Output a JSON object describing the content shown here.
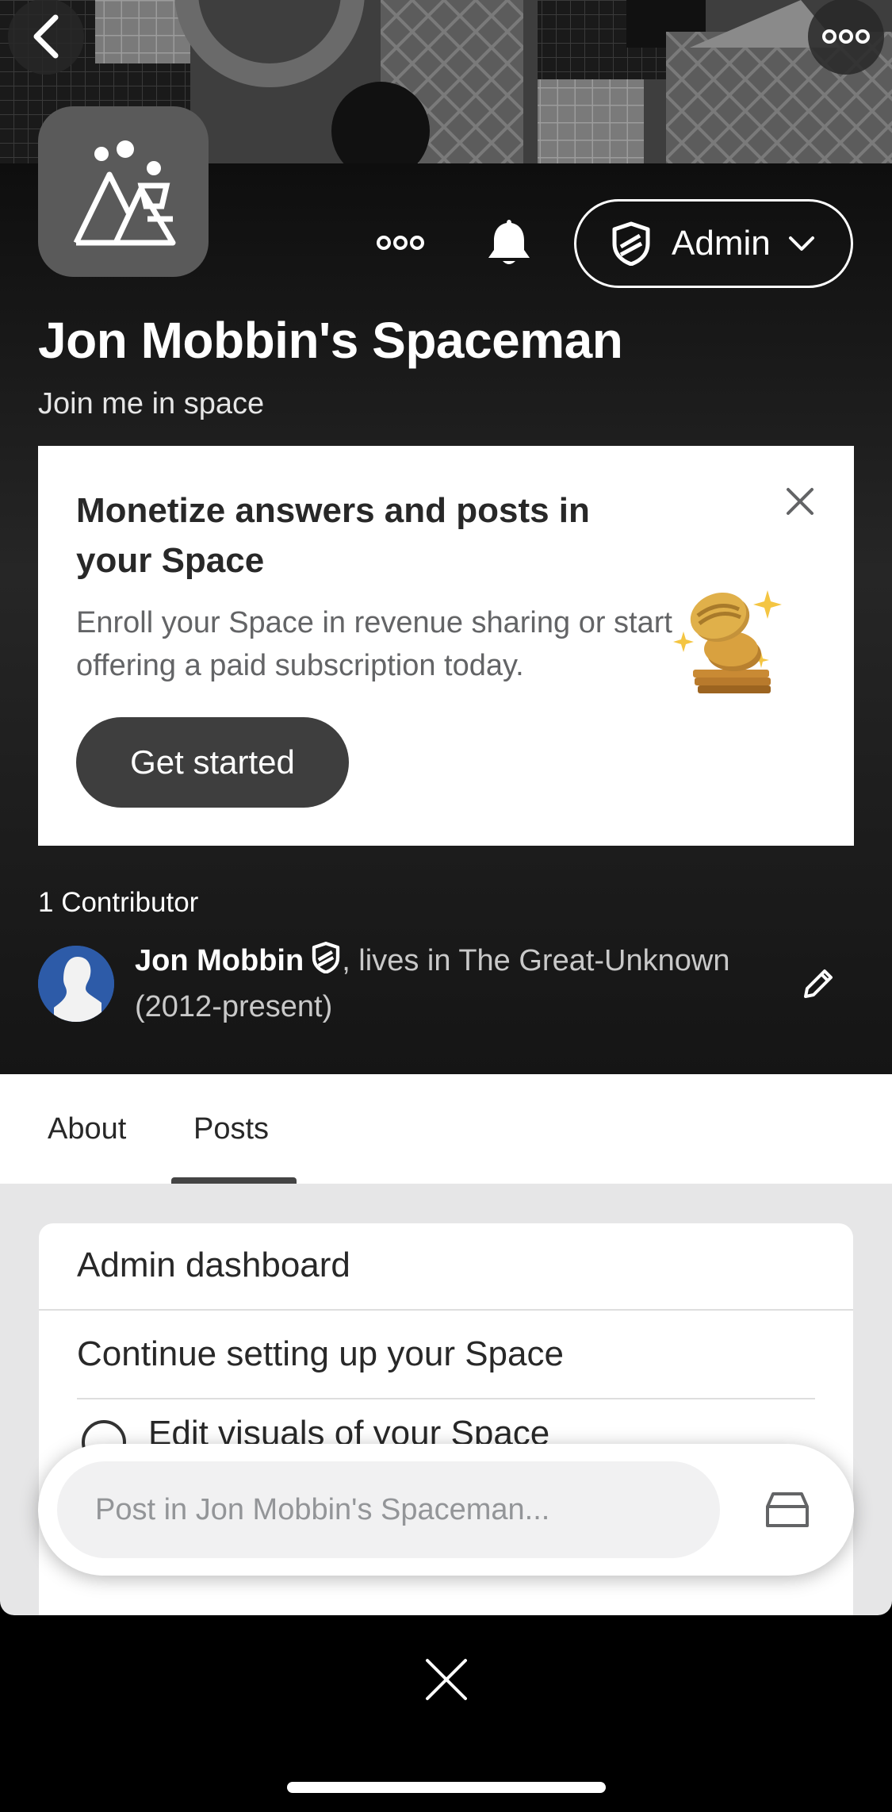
{
  "header": {
    "title": "Jon Mobbin's Spaceman",
    "tagline": "Join me in space",
    "admin_label": "Admin"
  },
  "promo": {
    "title": "Monetize answers and posts in your Space",
    "body": "Enroll your Space in revenue sharing or start offering a paid subscription today.",
    "cta": "Get started"
  },
  "contributors": {
    "count_label": "1 Contributor",
    "name": "Jon Mobbin",
    "credential": ", lives in The Great-Unknown (2012-present)"
  },
  "tabs": [
    {
      "label": "About",
      "active": false
    },
    {
      "label": "Posts",
      "active": true
    }
  ],
  "dashboard": {
    "title": "Admin dashboard",
    "subtitle": "Continue setting up your Space",
    "first_item": "Edit visuals of your Space"
  },
  "composer": {
    "placeholder": "Post in Jon Mobbin's Spaceman..."
  },
  "icons": {
    "back": "chevron-left-icon",
    "more": "more-horizontal-icon",
    "bell": "bell-icon",
    "shield": "shield-icon",
    "close": "close-icon",
    "edit": "pencil-icon",
    "drafts": "drafts-box-icon"
  },
  "colors": {
    "header_bg": "#1c1c1c",
    "button_dark": "#3e3e3e",
    "content_bg": "#e6e6e7"
  }
}
